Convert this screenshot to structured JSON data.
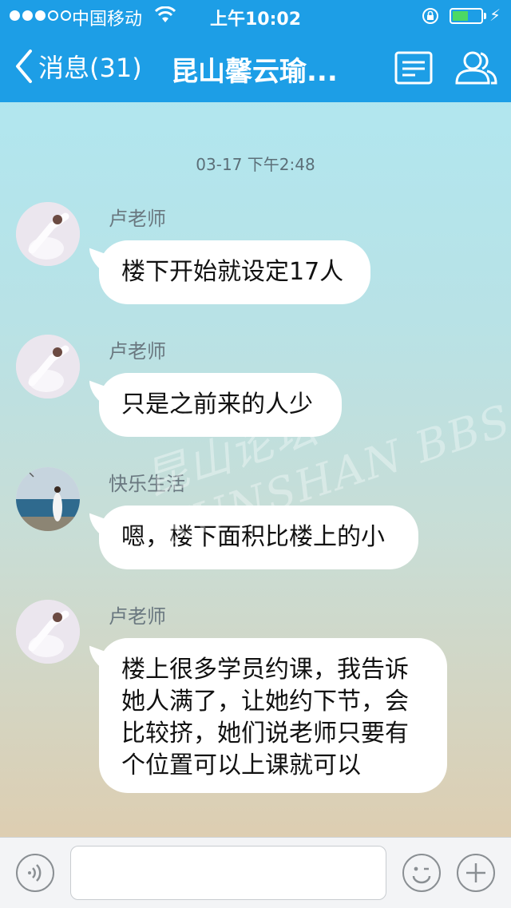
{
  "status_bar": {
    "carrier": "中国移动",
    "time": "上午10:02",
    "battery_level": 0.55
  },
  "nav": {
    "back_label": "消息(31)",
    "title": "昆山馨云瑜..."
  },
  "chat": {
    "timestamp": "03-17 下午2:48",
    "messages": [
      {
        "sender": "卢老师",
        "text": "楼下开始就设定17人"
      },
      {
        "sender": "卢老师",
        "text": "只是之前来的人少"
      },
      {
        "sender": "快乐生活",
        "text": "嗯，楼下面积比楼上的小"
      },
      {
        "sender": "卢老师",
        "text": "楼上很多学员约课，我告诉她人满了，让她约下节，会比较挤，她们说老师只要有个位置可以上课就可以"
      }
    ]
  },
  "watermark": "昆山论坛 KUNSHAN BBS",
  "input_bar": {
    "input_value": "",
    "icons": [
      "voice-icon",
      "emoji-icon",
      "plus-icon"
    ]
  },
  "colors": {
    "nav_bg": "#1d9ee6",
    "bubble_bg": "#ffffff",
    "battery_fill": "#4cd964"
  }
}
